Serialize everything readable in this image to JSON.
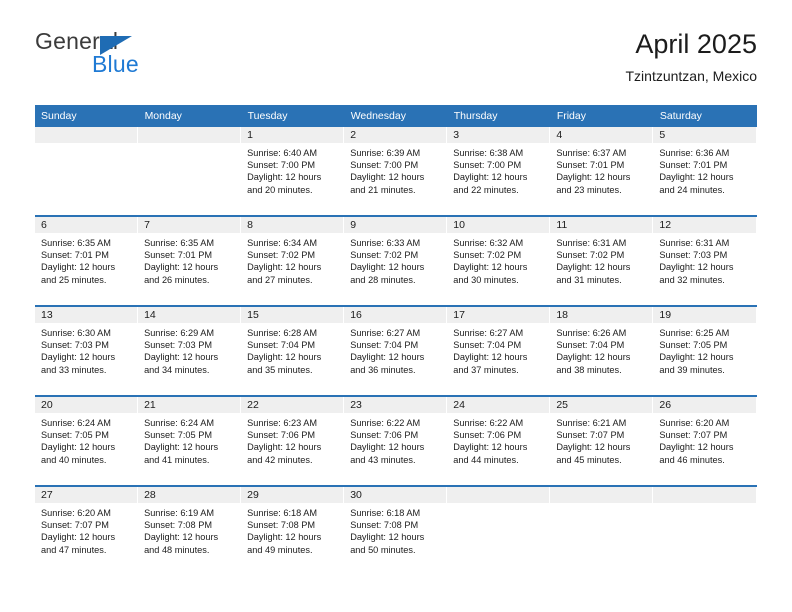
{
  "logo": {
    "word_top": "General",
    "word_bottom": "Blue",
    "triangle_icon": "triangle-icon",
    "color_blue": "#1f7ad4",
    "color_triangle": "#1f6cb4",
    "color_dark": "#3b3b3b"
  },
  "header": {
    "title": "April 2025",
    "subtitle": "Tzintzuntzan, Mexico"
  },
  "theme": {
    "accent": "#2a72b5",
    "band": "#efefef",
    "text": "#1c1c1c"
  },
  "calendar": {
    "weekday_headers": [
      "Sunday",
      "Monday",
      "Tuesday",
      "Wednesday",
      "Thursday",
      "Friday",
      "Saturday"
    ],
    "weeks": [
      [
        {
          "day": "",
          "empty": true,
          "sunrise": "",
          "sunset": "",
          "daylight_line1": "",
          "daylight_line2": ""
        },
        {
          "day": "",
          "empty": true,
          "sunrise": "",
          "sunset": "",
          "daylight_line1": "",
          "daylight_line2": ""
        },
        {
          "day": "1",
          "empty": false,
          "sunrise": "Sunrise: 6:40 AM",
          "sunset": "Sunset: 7:00 PM",
          "daylight_line1": "Daylight: 12 hours",
          "daylight_line2": "and 20 minutes."
        },
        {
          "day": "2",
          "empty": false,
          "sunrise": "Sunrise: 6:39 AM",
          "sunset": "Sunset: 7:00 PM",
          "daylight_line1": "Daylight: 12 hours",
          "daylight_line2": "and 21 minutes."
        },
        {
          "day": "3",
          "empty": false,
          "sunrise": "Sunrise: 6:38 AM",
          "sunset": "Sunset: 7:00 PM",
          "daylight_line1": "Daylight: 12 hours",
          "daylight_line2": "and 22 minutes."
        },
        {
          "day": "4",
          "empty": false,
          "sunrise": "Sunrise: 6:37 AM",
          "sunset": "Sunset: 7:01 PM",
          "daylight_line1": "Daylight: 12 hours",
          "daylight_line2": "and 23 minutes."
        },
        {
          "day": "5",
          "empty": false,
          "sunrise": "Sunrise: 6:36 AM",
          "sunset": "Sunset: 7:01 PM",
          "daylight_line1": "Daylight: 12 hours",
          "daylight_line2": "and 24 minutes."
        }
      ],
      [
        {
          "day": "6",
          "empty": false,
          "sunrise": "Sunrise: 6:35 AM",
          "sunset": "Sunset: 7:01 PM",
          "daylight_line1": "Daylight: 12 hours",
          "daylight_line2": "and 25 minutes."
        },
        {
          "day": "7",
          "empty": false,
          "sunrise": "Sunrise: 6:35 AM",
          "sunset": "Sunset: 7:01 PM",
          "daylight_line1": "Daylight: 12 hours",
          "daylight_line2": "and 26 minutes."
        },
        {
          "day": "8",
          "empty": false,
          "sunrise": "Sunrise: 6:34 AM",
          "sunset": "Sunset: 7:02 PM",
          "daylight_line1": "Daylight: 12 hours",
          "daylight_line2": "and 27 minutes."
        },
        {
          "day": "9",
          "empty": false,
          "sunrise": "Sunrise: 6:33 AM",
          "sunset": "Sunset: 7:02 PM",
          "daylight_line1": "Daylight: 12 hours",
          "daylight_line2": "and 28 minutes."
        },
        {
          "day": "10",
          "empty": false,
          "sunrise": "Sunrise: 6:32 AM",
          "sunset": "Sunset: 7:02 PM",
          "daylight_line1": "Daylight: 12 hours",
          "daylight_line2": "and 30 minutes."
        },
        {
          "day": "11",
          "empty": false,
          "sunrise": "Sunrise: 6:31 AM",
          "sunset": "Sunset: 7:02 PM",
          "daylight_line1": "Daylight: 12 hours",
          "daylight_line2": "and 31 minutes."
        },
        {
          "day": "12",
          "empty": false,
          "sunrise": "Sunrise: 6:31 AM",
          "sunset": "Sunset: 7:03 PM",
          "daylight_line1": "Daylight: 12 hours",
          "daylight_line2": "and 32 minutes."
        }
      ],
      [
        {
          "day": "13",
          "empty": false,
          "sunrise": "Sunrise: 6:30 AM",
          "sunset": "Sunset: 7:03 PM",
          "daylight_line1": "Daylight: 12 hours",
          "daylight_line2": "and 33 minutes."
        },
        {
          "day": "14",
          "empty": false,
          "sunrise": "Sunrise: 6:29 AM",
          "sunset": "Sunset: 7:03 PM",
          "daylight_line1": "Daylight: 12 hours",
          "daylight_line2": "and 34 minutes."
        },
        {
          "day": "15",
          "empty": false,
          "sunrise": "Sunrise: 6:28 AM",
          "sunset": "Sunset: 7:04 PM",
          "daylight_line1": "Daylight: 12 hours",
          "daylight_line2": "and 35 minutes."
        },
        {
          "day": "16",
          "empty": false,
          "sunrise": "Sunrise: 6:27 AM",
          "sunset": "Sunset: 7:04 PM",
          "daylight_line1": "Daylight: 12 hours",
          "daylight_line2": "and 36 minutes."
        },
        {
          "day": "17",
          "empty": false,
          "sunrise": "Sunrise: 6:27 AM",
          "sunset": "Sunset: 7:04 PM",
          "daylight_line1": "Daylight: 12 hours",
          "daylight_line2": "and 37 minutes."
        },
        {
          "day": "18",
          "empty": false,
          "sunrise": "Sunrise: 6:26 AM",
          "sunset": "Sunset: 7:04 PM",
          "daylight_line1": "Daylight: 12 hours",
          "daylight_line2": "and 38 minutes."
        },
        {
          "day": "19",
          "empty": false,
          "sunrise": "Sunrise: 6:25 AM",
          "sunset": "Sunset: 7:05 PM",
          "daylight_line1": "Daylight: 12 hours",
          "daylight_line2": "and 39 minutes."
        }
      ],
      [
        {
          "day": "20",
          "empty": false,
          "sunrise": "Sunrise: 6:24 AM",
          "sunset": "Sunset: 7:05 PM",
          "daylight_line1": "Daylight: 12 hours",
          "daylight_line2": "and 40 minutes."
        },
        {
          "day": "21",
          "empty": false,
          "sunrise": "Sunrise: 6:24 AM",
          "sunset": "Sunset: 7:05 PM",
          "daylight_line1": "Daylight: 12 hours",
          "daylight_line2": "and 41 minutes."
        },
        {
          "day": "22",
          "empty": false,
          "sunrise": "Sunrise: 6:23 AM",
          "sunset": "Sunset: 7:06 PM",
          "daylight_line1": "Daylight: 12 hours",
          "daylight_line2": "and 42 minutes."
        },
        {
          "day": "23",
          "empty": false,
          "sunrise": "Sunrise: 6:22 AM",
          "sunset": "Sunset: 7:06 PM",
          "daylight_line1": "Daylight: 12 hours",
          "daylight_line2": "and 43 minutes."
        },
        {
          "day": "24",
          "empty": false,
          "sunrise": "Sunrise: 6:22 AM",
          "sunset": "Sunset: 7:06 PM",
          "daylight_line1": "Daylight: 12 hours",
          "daylight_line2": "and 44 minutes."
        },
        {
          "day": "25",
          "empty": false,
          "sunrise": "Sunrise: 6:21 AM",
          "sunset": "Sunset: 7:07 PM",
          "daylight_line1": "Daylight: 12 hours",
          "daylight_line2": "and 45 minutes."
        },
        {
          "day": "26",
          "empty": false,
          "sunrise": "Sunrise: 6:20 AM",
          "sunset": "Sunset: 7:07 PM",
          "daylight_line1": "Daylight: 12 hours",
          "daylight_line2": "and 46 minutes."
        }
      ],
      [
        {
          "day": "27",
          "empty": false,
          "sunrise": "Sunrise: 6:20 AM",
          "sunset": "Sunset: 7:07 PM",
          "daylight_line1": "Daylight: 12 hours",
          "daylight_line2": "and 47 minutes."
        },
        {
          "day": "28",
          "empty": false,
          "sunrise": "Sunrise: 6:19 AM",
          "sunset": "Sunset: 7:08 PM",
          "daylight_line1": "Daylight: 12 hours",
          "daylight_line2": "and 48 minutes."
        },
        {
          "day": "29",
          "empty": false,
          "sunrise": "Sunrise: 6:18 AM",
          "sunset": "Sunset: 7:08 PM",
          "daylight_line1": "Daylight: 12 hours",
          "daylight_line2": "and 49 minutes."
        },
        {
          "day": "30",
          "empty": false,
          "sunrise": "Sunrise: 6:18 AM",
          "sunset": "Sunset: 7:08 PM",
          "daylight_line1": "Daylight: 12 hours",
          "daylight_line2": "and 50 minutes."
        },
        {
          "day": "",
          "empty": true,
          "sunrise": "",
          "sunset": "",
          "daylight_line1": "",
          "daylight_line2": ""
        },
        {
          "day": "",
          "empty": true,
          "sunrise": "",
          "sunset": "",
          "daylight_line1": "",
          "daylight_line2": ""
        },
        {
          "day": "",
          "empty": true,
          "sunrise": "",
          "sunset": "",
          "daylight_line1": "",
          "daylight_line2": ""
        }
      ]
    ]
  }
}
